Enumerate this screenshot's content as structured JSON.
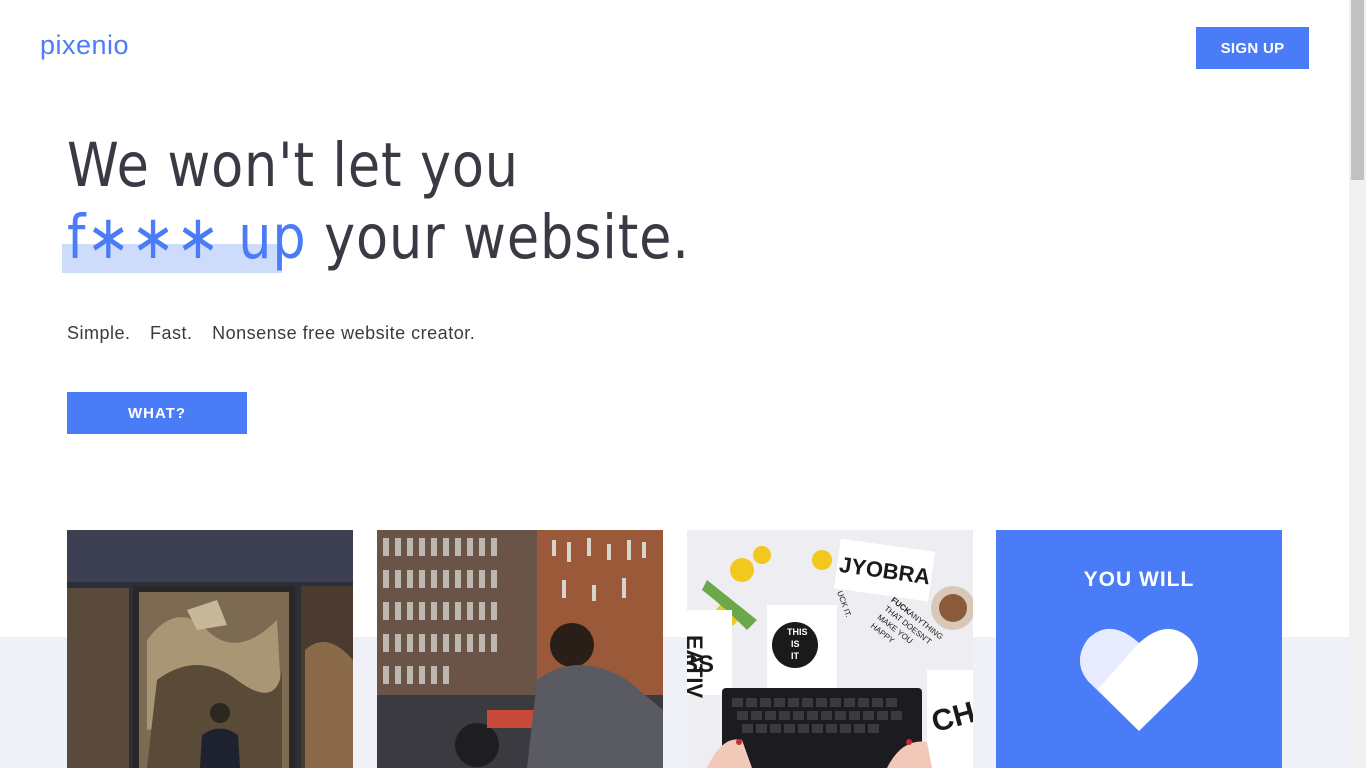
{
  "header": {
    "logo": "pixenio",
    "signup_label": "SIGN UP"
  },
  "hero": {
    "line1": "We won't let you",
    "censored": "f∗∗∗ up",
    "line2_rest": " your website.",
    "tagline": [
      "Simple.",
      "Fast.",
      "Nonsense free website creator."
    ],
    "cta_label": "WHAT?"
  },
  "cards": [
    {
      "name": "gallery-painting-photo",
      "kind": "image"
    },
    {
      "name": "workshop-photo",
      "kind": "image"
    },
    {
      "name": "desk-keyboard-photo",
      "kind": "image"
    },
    {
      "name": "you-will-card",
      "kind": "promo",
      "title": "YOU WILL",
      "icon": "heart-icon"
    }
  ],
  "card3_text": {
    "word_top": "JYOBRA",
    "sticker": [
      "THIS",
      "IS",
      "IT"
    ],
    "note_bold": "FUCK",
    "note_rest": [
      "ANYTHING",
      "THAT DOESN'T",
      "MAKE YOU",
      "HAPPY"
    ],
    "side_left": [
      "EATIV",
      "SS"
    ],
    "side_right": "CHA",
    "tilted": "UCK IT."
  },
  "colors": {
    "accent": "#4a7cf7",
    "highlight": "#c8d8fa",
    "text": "#3a3a44",
    "band": "#f0f0f8"
  }
}
